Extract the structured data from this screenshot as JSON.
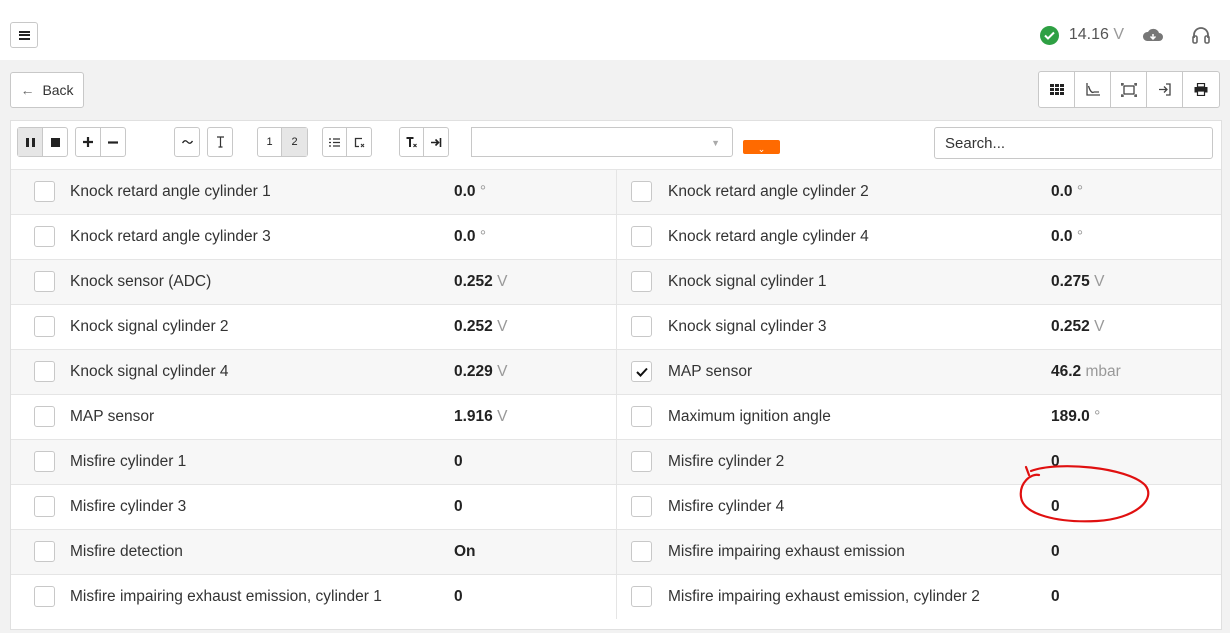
{
  "status": {
    "voltage_value": "14.16",
    "voltage_unit": "V"
  },
  "nav": {
    "back_label": "Back"
  },
  "toolbar": {
    "page_1": "1",
    "page_2": "2",
    "search_placeholder": "Search..."
  },
  "rows": [
    [
      {
        "label": "Knock retard angle cylinder 1",
        "num": "0.0",
        "unit": "°",
        "checked": false
      },
      {
        "label": "Knock retard angle cylinder 2",
        "num": "0.0",
        "unit": "°",
        "checked": false
      }
    ],
    [
      {
        "label": "Knock retard angle cylinder 3",
        "num": "0.0",
        "unit": "°",
        "checked": false
      },
      {
        "label": "Knock retard angle cylinder 4",
        "num": "0.0",
        "unit": "°",
        "checked": false
      }
    ],
    [
      {
        "label": "Knock sensor (ADC)",
        "num": "0.252",
        "unit": "V",
        "checked": false
      },
      {
        "label": "Knock signal cylinder 1",
        "num": "0.275",
        "unit": "V",
        "checked": false
      }
    ],
    [
      {
        "label": "Knock signal cylinder 2",
        "num": "0.252",
        "unit": "V",
        "checked": false
      },
      {
        "label": "Knock signal cylinder 3",
        "num": "0.252",
        "unit": "V",
        "checked": false
      }
    ],
    [
      {
        "label": "Knock signal cylinder 4",
        "num": "0.229",
        "unit": "V",
        "checked": false
      },
      {
        "label": "MAP sensor",
        "num": "46.2",
        "unit": "mbar",
        "checked": true
      }
    ],
    [
      {
        "label": "MAP sensor",
        "num": "1.916",
        "unit": "V",
        "checked": false
      },
      {
        "label": "Maximum ignition angle",
        "num": "189.0",
        "unit": "°",
        "checked": false
      }
    ],
    [
      {
        "label": "Misfire cylinder 1",
        "num": "0",
        "unit": "",
        "checked": false
      },
      {
        "label": "Misfire cylinder 2",
        "num": "0",
        "unit": "",
        "checked": false
      }
    ],
    [
      {
        "label": "Misfire cylinder 3",
        "num": "0",
        "unit": "",
        "checked": false
      },
      {
        "label": "Misfire cylinder 4",
        "num": "0",
        "unit": "",
        "checked": false
      }
    ],
    [
      {
        "label": "Misfire detection",
        "num": "On",
        "unit": "",
        "checked": false
      },
      {
        "label": "Misfire impairing exhaust emission",
        "num": "0",
        "unit": "",
        "checked": false
      }
    ],
    [
      {
        "label": "Misfire impairing exhaust emission, cylinder 1",
        "num": "0",
        "unit": "",
        "checked": false
      },
      {
        "label": "Misfire impairing exhaust emission, cylinder 2",
        "num": "0",
        "unit": "",
        "checked": false
      }
    ]
  ],
  "colors": {
    "accent_orange": "#ff6a00",
    "status_green": "#2ea043",
    "annotation_red": "#e01010"
  }
}
